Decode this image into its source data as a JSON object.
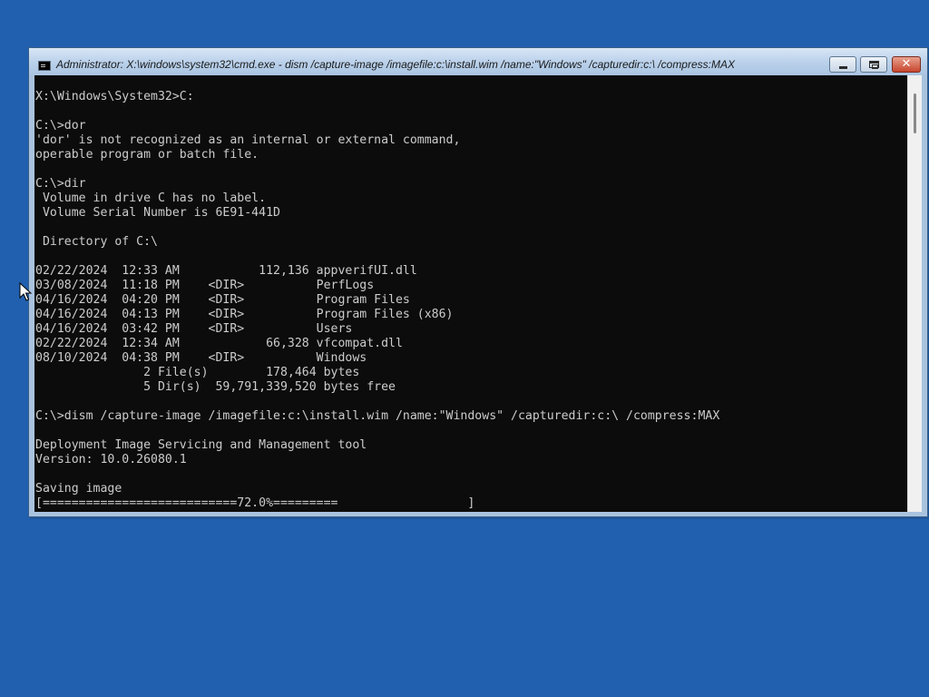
{
  "window": {
    "title": "Administrator: X:\\windows\\system32\\cmd.exe - dism  /capture-image /imagefile:c:\\install.wim /name:\"Windows\" /capturedir:c:\\ /compress:MAX",
    "controls": {
      "minimize_icon": "minimize-icon",
      "maximize_icon": "maximize-icon",
      "close_glyph": "✕"
    }
  },
  "console": {
    "lines": [
      "",
      "X:\\Windows\\System32>C:",
      "",
      "C:\\>dor",
      "'dor' is not recognized as an internal or external command,",
      "operable program or batch file.",
      "",
      "C:\\>dir",
      " Volume in drive C has no label.",
      " Volume Serial Number is 6E91-441D",
      "",
      " Directory of C:\\",
      "",
      "02/22/2024  12:33 AM           112,136 appverifUI.dll",
      "03/08/2024  11:18 PM    <DIR>          PerfLogs",
      "04/16/2024  04:20 PM    <DIR>          Program Files",
      "04/16/2024  04:13 PM    <DIR>          Program Files (x86)",
      "04/16/2024  03:42 PM    <DIR>          Users",
      "02/22/2024  12:34 AM            66,328 vfcompat.dll",
      "08/10/2024  04:38 PM    <DIR>          Windows",
      "               2 File(s)        178,464 bytes",
      "               5 Dir(s)  59,791,339,520 bytes free",
      "",
      "C:\\>dism /capture-image /imagefile:c:\\install.wim /name:\"Windows\" /capturedir:c:\\ /compress:MAX",
      "",
      "Deployment Image Servicing and Management tool",
      "Version: 10.0.26080.1",
      "",
      "Saving image",
      "[===========================72.0%=========                  ]"
    ],
    "progress_percent": 72.0
  },
  "colors": {
    "desktop": "#2160AE",
    "console_bg": "#0C0C0C",
    "console_text": "#CCCCCC",
    "close_button": "#C8462E"
  }
}
